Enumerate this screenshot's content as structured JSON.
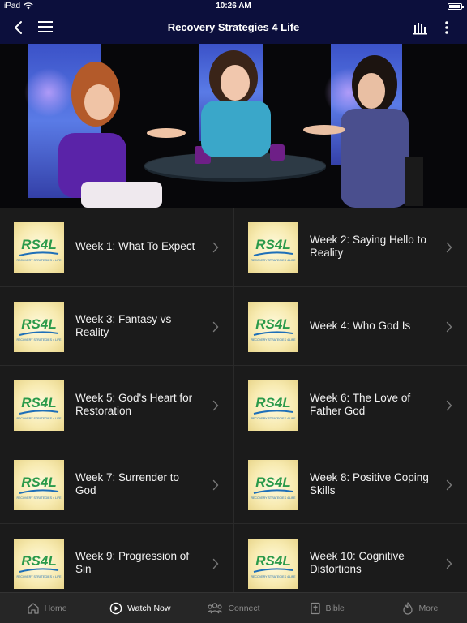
{
  "status": {
    "device": "iPad",
    "time": "10:26 AM",
    "battery_level": 0.8
  },
  "nav": {
    "title": "Recovery Strategies 4 Life"
  },
  "thumbnail_logo": {
    "text": "RS4L",
    "tagline": "RECOVERY STRATEGIES 4 LIFE",
    "colors": {
      "primary": "#2a9a4a",
      "accent": "#1e6fb8"
    }
  },
  "episodes": [
    {
      "title": "Week 1: What To Expect"
    },
    {
      "title": "Week 2: Saying Hello to Reality"
    },
    {
      "title": "Week 3: Fantasy vs Reality"
    },
    {
      "title": "Week 4: Who God Is"
    },
    {
      "title": "Week 5: God's Heart for Restoration"
    },
    {
      "title": "Week 6: The Love of Father God"
    },
    {
      "title": "Week 7: Surrender to God"
    },
    {
      "title": "Week 8: Positive Coping Skills"
    },
    {
      "title": "Week 9: Progression of Sin"
    },
    {
      "title": "Week 10: Cognitive Distortions"
    }
  ],
  "tabs": [
    {
      "label": "Home",
      "icon": "home-icon"
    },
    {
      "label": "Watch Now",
      "icon": "play-circle-icon",
      "active": true
    },
    {
      "label": "Connect",
      "icon": "people-icon"
    },
    {
      "label": "Bible",
      "icon": "bible-icon"
    },
    {
      "label": "More",
      "icon": "flame-icon"
    }
  ],
  "colors": {
    "nav_bg": "#0c0f3c",
    "cell_bg": "#1b1b1b",
    "tab_bg": "#262626"
  }
}
